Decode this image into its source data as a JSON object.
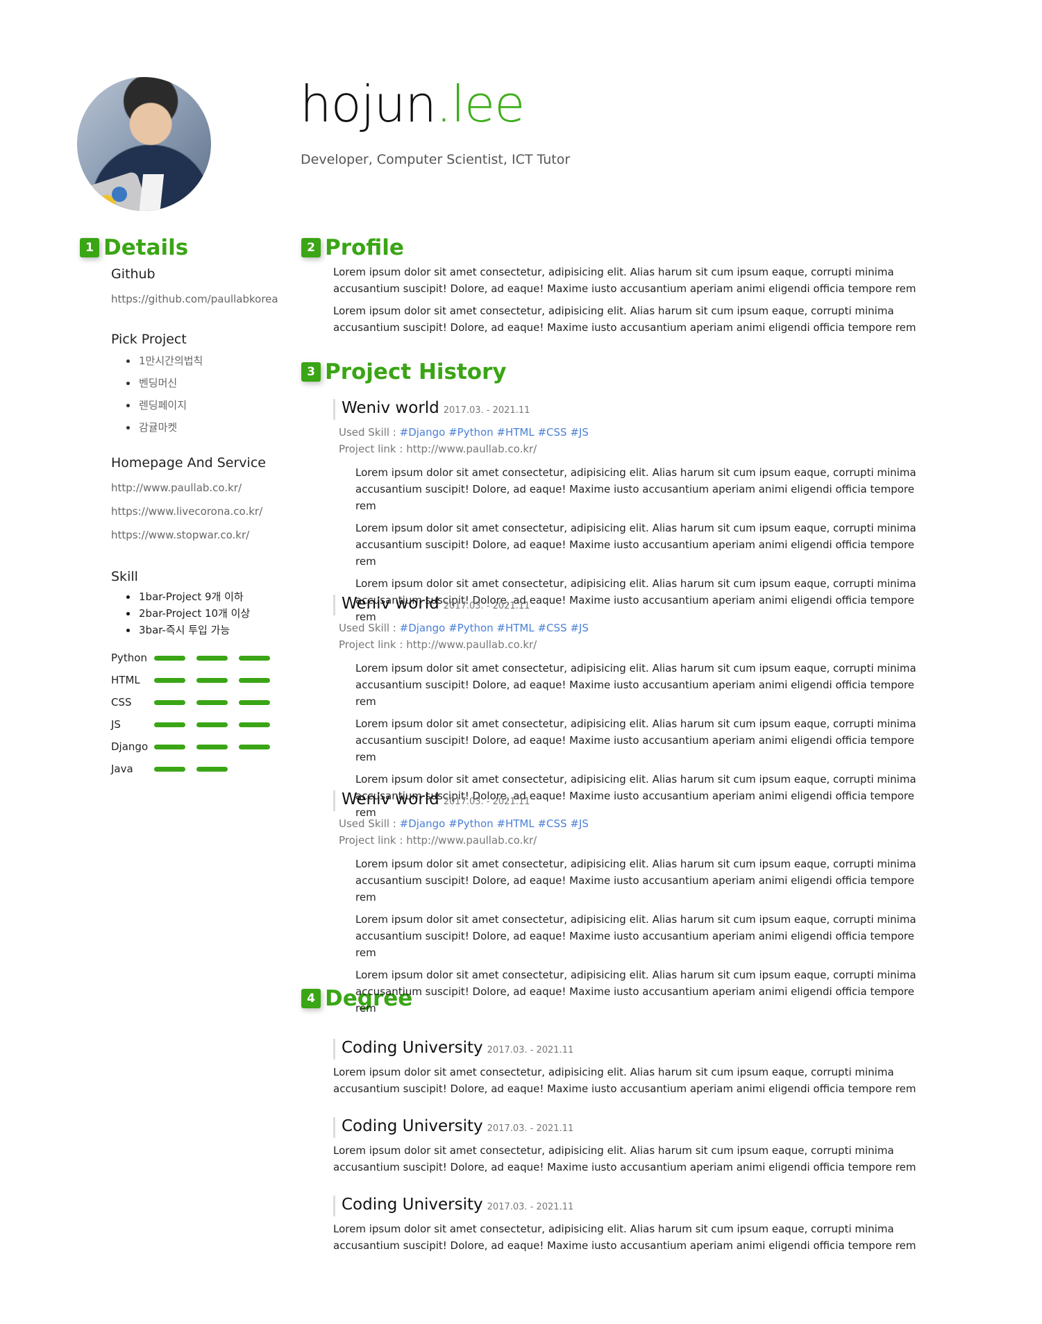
{
  "header": {
    "name_first": "hojun",
    "name_dot": ".lee",
    "subtitle": "Developer, Computer Scientist, ICT Tutor"
  },
  "sections": {
    "details": {
      "num": "1",
      "title": "Details"
    },
    "profile": {
      "num": "2",
      "title": "Profile"
    },
    "history": {
      "num": "3",
      "title": "Project History"
    },
    "degree": {
      "num": "4",
      "title": "Degree"
    }
  },
  "details": {
    "github_label": "Github",
    "github_url": "https://github.com/paullabkorea",
    "pick_label": "Pick Project",
    "pick_items": [
      "1만시간의법칙",
      "벤딩머신",
      "렌딩페이지",
      "감귤마켓"
    ],
    "homepage_label": "Homepage And Service",
    "homepage_links": [
      "http://www.paullab.co.kr/",
      "https://www.livecorona.co.kr/",
      "https://www.stopwar.co.kr/"
    ],
    "skill_label": "Skill",
    "skill_legend": [
      "1bar-Project 9개 이하",
      "2bar-Project 10개 이상",
      "3bar-즉시 투입 가능"
    ],
    "skills": [
      {
        "name": "Python",
        "level": 3
      },
      {
        "name": "HTML",
        "level": 3
      },
      {
        "name": "CSS",
        "level": 3
      },
      {
        "name": "JS",
        "level": 3
      },
      {
        "name": "Django",
        "level": 3
      },
      {
        "name": "Java",
        "level": 2
      }
    ]
  },
  "profile": {
    "paragraphs": [
      "Lorem ipsum dolor sit amet consectetur, adipisicing elit. Alias harum sit cum ipsum eaque, corrupti minima accusantium suscipit! Dolore, ad eaque! Maxime iusto accusantium aperiam animi eligendi officia tempore rem",
      "Lorem ipsum dolor sit amet consectetur, adipisicing elit. Alias harum sit cum ipsum eaque, corrupti minima accusantium suscipit! Dolore, ad eaque! Maxime iusto accusantium aperiam animi eligendi officia tempore rem"
    ]
  },
  "projects": [
    {
      "title": "Weniv world",
      "date": "2017.03. - 2021.11",
      "skill_label": "Used Skill : ",
      "tags": "#Django #Python #HTML #CSS #JS",
      "link_label": "Project link : ",
      "link": "http://www.paullab.co.kr/",
      "paragraphs": [
        "Lorem ipsum dolor sit amet consectetur, adipisicing elit. Alias harum sit cum ipsum eaque, corrupti minima accusantium suscipit! Dolore, ad eaque! Maxime iusto accusantium aperiam animi eligendi officia tempore rem",
        "Lorem ipsum dolor sit amet consectetur, adipisicing elit. Alias harum sit cum ipsum eaque, corrupti minima accusantium suscipit! Dolore, ad eaque! Maxime iusto accusantium aperiam animi eligendi officia tempore rem",
        "Lorem ipsum dolor sit amet consectetur, adipisicing elit. Alias harum sit cum ipsum eaque, corrupti minima accusantium suscipit! Dolore, ad eaque! Maxime iusto accusantium aperiam animi eligendi officia tempore rem"
      ]
    },
    {
      "title": "Weniv world",
      "date": "2017.03. - 2021.11",
      "skill_label": "Used Skill : ",
      "tags": "#Django #Python #HTML #CSS #JS",
      "link_label": "Project link : ",
      "link": "http://www.paullab.co.kr/",
      "paragraphs": [
        "Lorem ipsum dolor sit amet consectetur, adipisicing elit. Alias harum sit cum ipsum eaque, corrupti minima accusantium suscipit! Dolore, ad eaque! Maxime iusto accusantium aperiam animi eligendi officia tempore rem",
        "Lorem ipsum dolor sit amet consectetur, adipisicing elit. Alias harum sit cum ipsum eaque, corrupti minima accusantium suscipit! Dolore, ad eaque! Maxime iusto accusantium aperiam animi eligendi officia tempore rem",
        "Lorem ipsum dolor sit amet consectetur, adipisicing elit. Alias harum sit cum ipsum eaque, corrupti minima accusantium suscipit! Dolore, ad eaque! Maxime iusto accusantium aperiam animi eligendi officia tempore rem"
      ]
    },
    {
      "title": "Weniv world",
      "date": "2017.03. - 2021.11",
      "skill_label": "Used Skill : ",
      "tags": "#Django #Python #HTML #CSS #JS",
      "link_label": "Project link : ",
      "link": "http://www.paullab.co.kr/",
      "paragraphs": [
        "Lorem ipsum dolor sit amet consectetur, adipisicing elit. Alias harum sit cum ipsum eaque, corrupti minima accusantium suscipit! Dolore, ad eaque! Maxime iusto accusantium aperiam animi eligendi officia tempore rem",
        "Lorem ipsum dolor sit amet consectetur, adipisicing elit. Alias harum sit cum ipsum eaque, corrupti minima accusantium suscipit! Dolore, ad eaque! Maxime iusto accusantium aperiam animi eligendi officia tempore rem",
        "Lorem ipsum dolor sit amet consectetur, adipisicing elit. Alias harum sit cum ipsum eaque, corrupti minima accusantium suscipit! Dolore, ad eaque! Maxime iusto accusantium aperiam animi eligendi officia tempore rem"
      ]
    }
  ],
  "degrees": [
    {
      "title": "Coding University",
      "date": "2017.03. - 2021.11",
      "text": "Lorem ipsum dolor sit amet consectetur, adipisicing elit. Alias harum sit cum ipsum eaque, corrupti minima accusantium suscipit! Dolore, ad eaque! Maxime iusto accusantium aperiam animi eligendi officia tempore rem"
    },
    {
      "title": "Coding University",
      "date": "2017.03. - 2021.11",
      "text": "Lorem ipsum dolor sit amet consectetur, adipisicing elit. Alias harum sit cum ipsum eaque, corrupti minima accusantium suscipit! Dolore, ad eaque! Maxime iusto accusantium aperiam animi eligendi officia tempore rem"
    },
    {
      "title": "Coding University",
      "date": "2017.03. - 2021.11",
      "text": "Lorem ipsum dolor sit amet consectetur, adipisicing elit. Alias harum sit cum ipsum eaque, corrupti minima accusantium suscipit! Dolore, ad eaque! Maxime iusto accusantium aperiam animi eligendi officia tempore rem"
    }
  ],
  "colors": {
    "accent": "#3aa515",
    "tag": "#4a7fd6"
  }
}
